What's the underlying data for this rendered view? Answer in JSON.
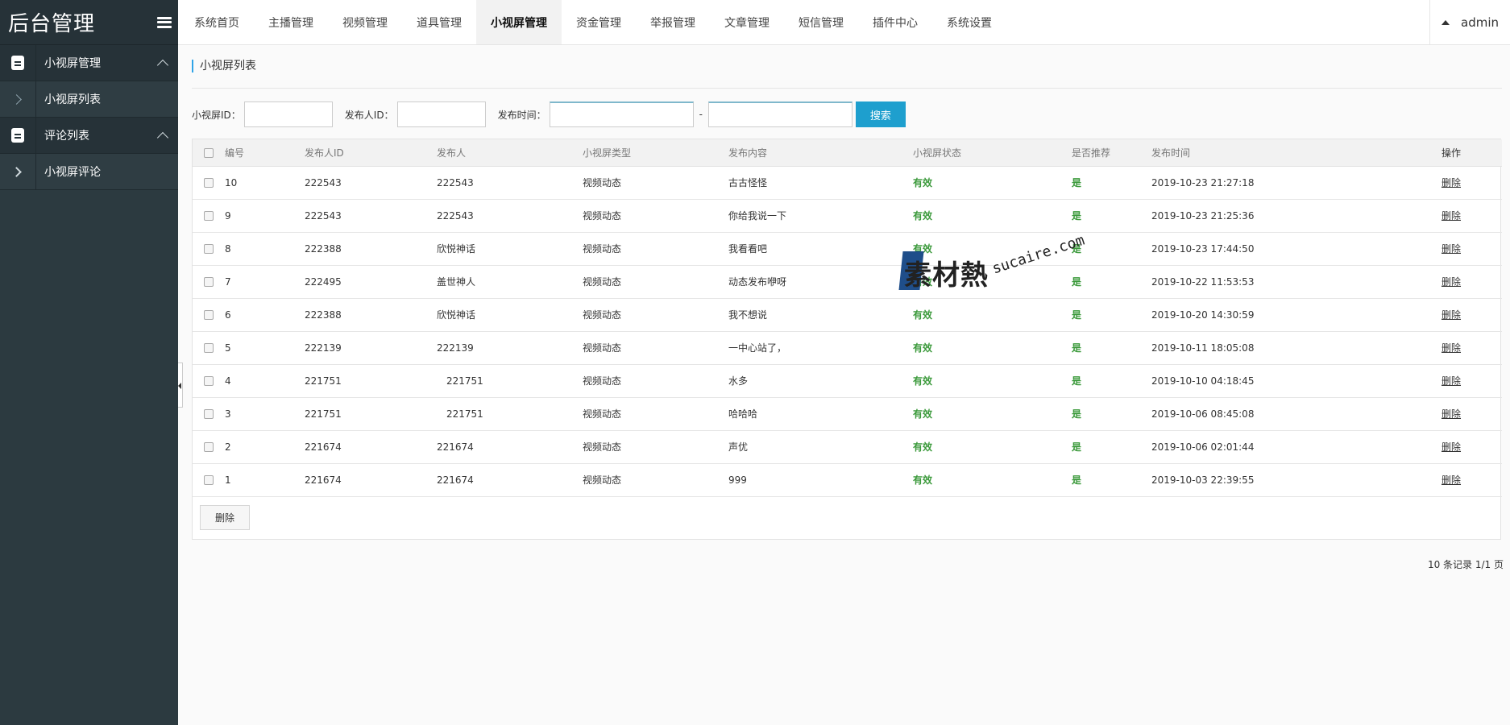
{
  "brand": {
    "title": "后台管理"
  },
  "sidebar": {
    "rows": [
      {
        "label": "小视屏管理",
        "type": "group"
      },
      {
        "label": "小视屏列表",
        "type": "sub"
      },
      {
        "label": "评论列表",
        "type": "group"
      },
      {
        "label": "小视屏评论",
        "type": "sub"
      }
    ]
  },
  "topnav": {
    "tabs": [
      "系统首页",
      "主播管理",
      "视频管理",
      "道具管理",
      "小视屏管理",
      "资金管理",
      "举报管理",
      "文章管理",
      "短信管理",
      "插件中心",
      "系统设置"
    ],
    "active_index": 4,
    "user": "admin"
  },
  "page": {
    "title": "小视屏列表"
  },
  "filters": {
    "id_label": "小视屏ID：",
    "id_value": "",
    "publisher_label": "发布人ID：",
    "publisher_value": "",
    "time_label": "发布时间：",
    "time_start": "",
    "time_sep": "-",
    "time_end": "",
    "search_button": "搜索"
  },
  "table": {
    "columns": [
      "编号",
      "发布人ID",
      "发布人",
      "小视屏类型",
      "发布内容",
      "小视屏状态",
      "是否推荐",
      "发布时间",
      "操作"
    ],
    "rows": [
      {
        "id": "10",
        "publisher_id": "222543",
        "publisher": "222543",
        "type": "视频动态",
        "content": "古古怪怪",
        "status": "有效",
        "recommended": "是",
        "time": "2019-10-23 21:27:18",
        "action": "删除"
      },
      {
        "id": "9",
        "publisher_id": "222543",
        "publisher": "222543",
        "type": "视频动态",
        "content": "你给我说一下",
        "status": "有效",
        "recommended": "是",
        "time": "2019-10-23 21:25:36",
        "action": "删除"
      },
      {
        "id": "8",
        "publisher_id": "222388",
        "publisher": "欣悦神话",
        "type": "视频动态",
        "content": "我看看吧",
        "status": "有效",
        "recommended": "是",
        "time": "2019-10-23 17:44:50",
        "action": "删除"
      },
      {
        "id": "7",
        "publisher_id": "222495",
        "publisher": "盖世神人",
        "type": "视频动态",
        "content": "动态发布咿呀",
        "status": "有效",
        "recommended": "是",
        "time": "2019-10-22 11:53:53",
        "action": "删除"
      },
      {
        "id": "6",
        "publisher_id": "222388",
        "publisher": "欣悦神话",
        "type": "视频动态",
        "content": "我不想说",
        "status": "有效",
        "recommended": "是",
        "time": "2019-10-20 14:30:59",
        "action": "删除"
      },
      {
        "id": "5",
        "publisher_id": "222139",
        "publisher": "222139",
        "type": "视频动态",
        "content": "一中心站了，",
        "status": "有效",
        "recommended": "是",
        "time": "2019-10-11 18:05:08",
        "action": "删除"
      },
      {
        "id": "4",
        "publisher_id": "221751",
        "publisher": "221751",
        "type": "视频动态",
        "content": "水多",
        "status": "有效",
        "recommended": "是",
        "time": "2019-10-10 04:18:45",
        "action": "删除"
      },
      {
        "id": "3",
        "publisher_id": "221751",
        "publisher": "221751",
        "type": "视频动态",
        "content": "哈哈哈",
        "status": "有效",
        "recommended": "是",
        "time": "2019-10-06 08:45:08",
        "action": "删除"
      },
      {
        "id": "2",
        "publisher_id": "221674",
        "publisher": "221674",
        "type": "视频动态",
        "content": "声优",
        "status": "有效",
        "recommended": "是",
        "time": "2019-10-06 02:01:44",
        "action": "删除"
      },
      {
        "id": "1",
        "publisher_id": "221674",
        "publisher": "221674",
        "type": "视频动态",
        "content": "999",
        "status": "有效",
        "recommended": "是",
        "time": "2019-10-03 22:39:55",
        "action": "删除"
      }
    ],
    "batch_delete": "删除"
  },
  "pager": {
    "summary": "10 条记录 1/1 页"
  },
  "watermark": {
    "cn": "素材熱",
    "en": "sucaire.com"
  },
  "colors": {
    "sidebar_bg": "#2c3a40",
    "accent": "#1e9fce",
    "status_green": "#3c9a3c"
  }
}
